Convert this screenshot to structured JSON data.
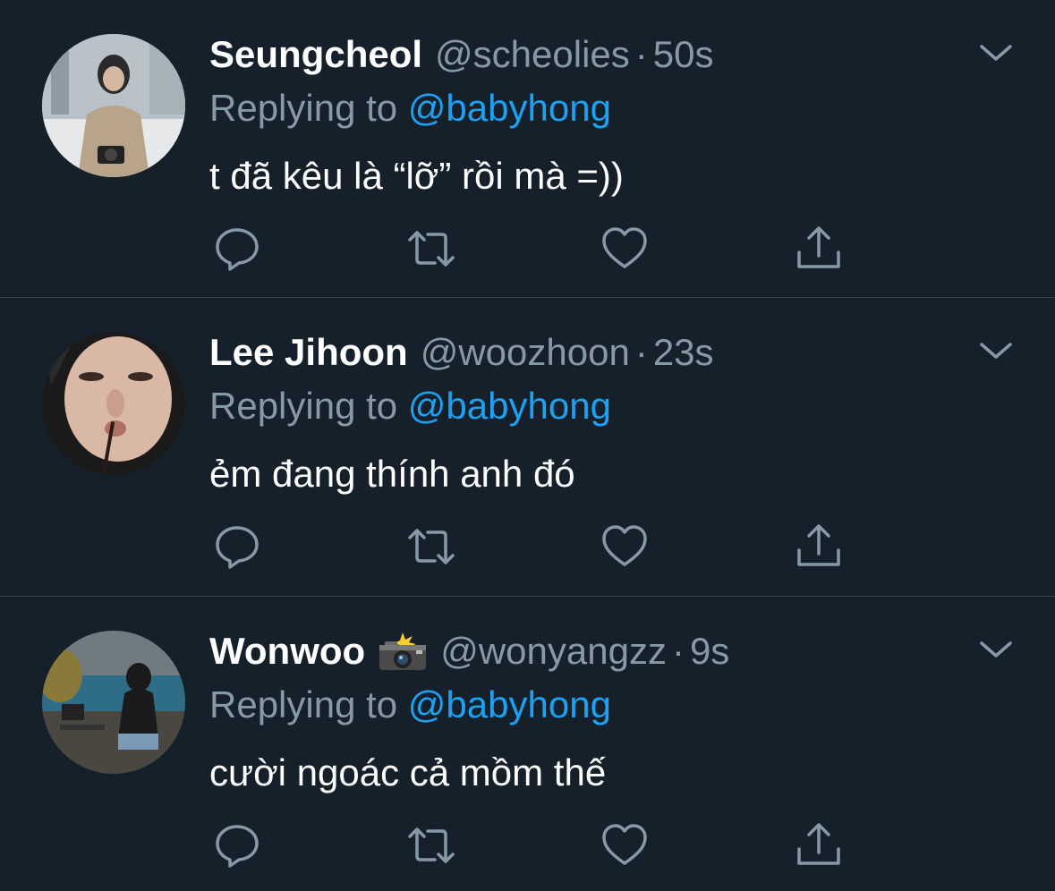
{
  "tweets": [
    {
      "name": "Seungcheol",
      "handle": "@scheolies",
      "separator": "·",
      "time": "50s",
      "replying_prefix": "Replying to",
      "replying_to": "@babyhong",
      "text": "t đã kêu là “lỡ” rồi mà =))",
      "name_emoji": ""
    },
    {
      "name": "Lee Jihoon",
      "handle": "@woozhoon",
      "separator": "·",
      "time": "23s",
      "replying_prefix": "Replying to",
      "replying_to": "@babyhong",
      "text": "ẻm đang thính anh đó",
      "name_emoji": ""
    },
    {
      "name": "Wonwoo",
      "handle": "@wonyangzz",
      "separator": "·",
      "time": "9s",
      "replying_prefix": "Replying to",
      "replying_to": "@babyhong",
      "text": "cười ngoác cả mồm thế",
      "name_emoji": "camera-with-flash"
    }
  ],
  "icons": {
    "reply": "reply-icon",
    "retweet": "retweet-icon",
    "like": "like-icon",
    "share": "share-icon",
    "menu": "chevron-down-icon"
  },
  "colors": {
    "background": "#15202b",
    "divider": "#38444d",
    "secondary_text": "#8899a6",
    "link": "#1da1f2",
    "primary_text": "#ffffff"
  }
}
